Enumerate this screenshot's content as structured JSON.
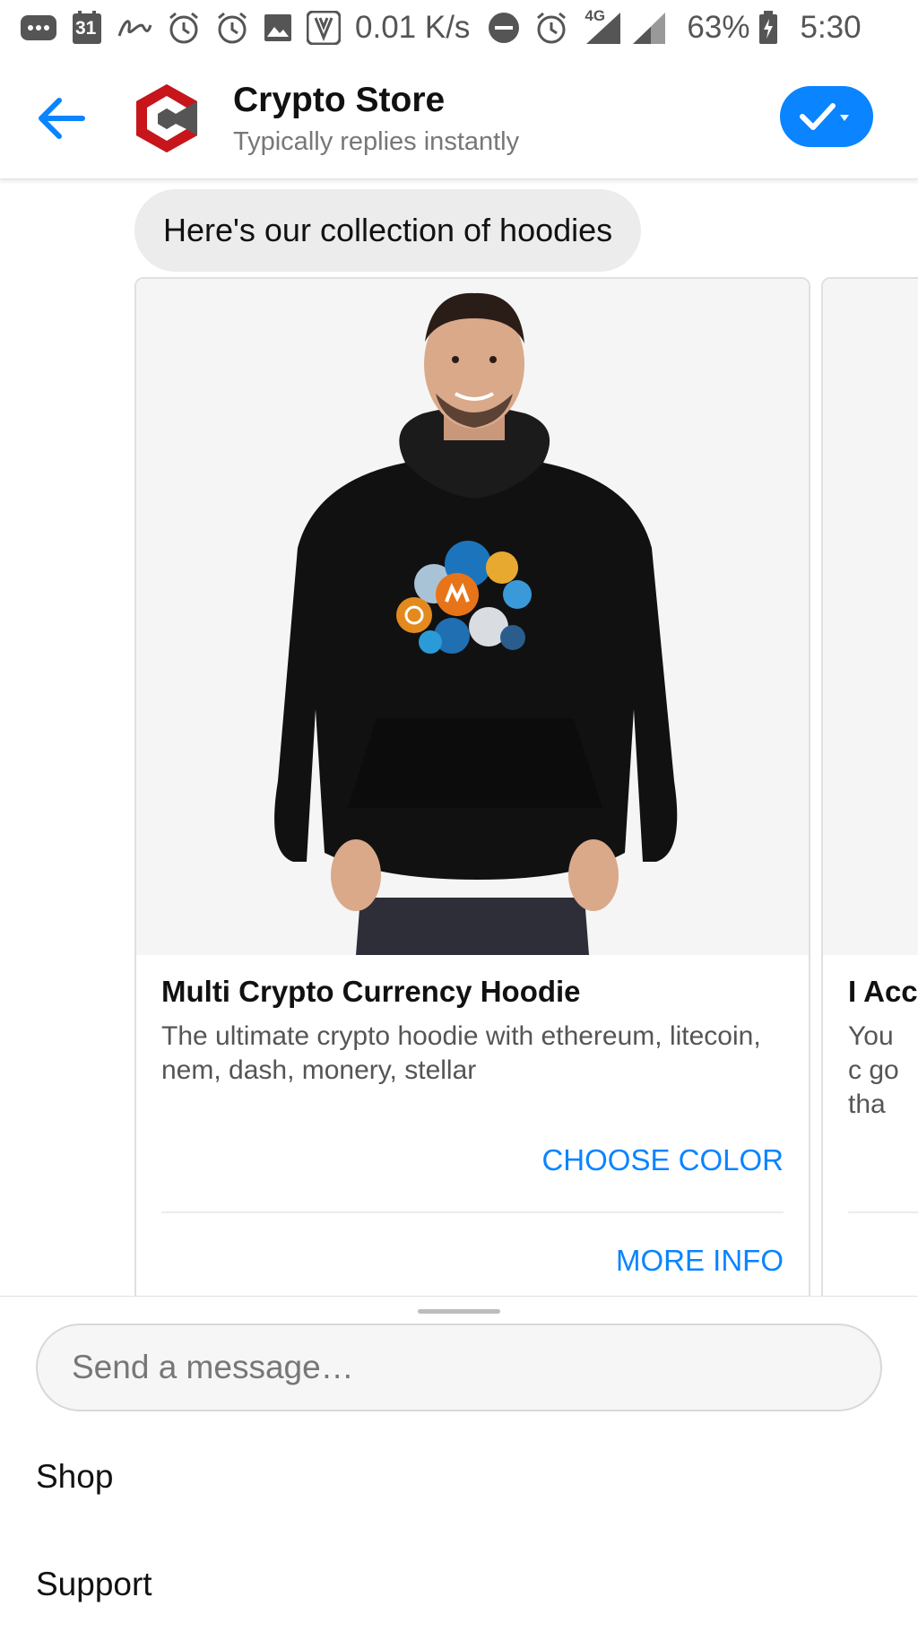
{
  "status_bar": {
    "calendar_day": "31",
    "net_speed": "0.01 K/s",
    "network": "4G",
    "battery": "63%",
    "time": "5:30",
    "icons": [
      "more-icon",
      "calendar-icon",
      "signature-icon",
      "alarm-icon",
      "alarm-icon",
      "image-icon",
      "app-icon",
      "dnd-icon",
      "alarm-icon",
      "signal-icon",
      "signal-icon",
      "battery-icon"
    ]
  },
  "header": {
    "title": "Crypto Store",
    "subtitle": "Typically replies instantly",
    "back_icon": "back-arrow-icon",
    "action_icon": "check-dropdown-icon",
    "accent_color": "#0a84ff"
  },
  "chat": {
    "bubble_text": "Here's our collection of hoodies",
    "cards": [
      {
        "title": "Multi Crypto Currency Hoodie",
        "description": "The ultimate crypto hoodie with ethereum, litecoin, nem, dash, monery, stellar",
        "buttons": [
          "CHOOSE COLOR",
          "MORE INFO"
        ]
      },
      {
        "title": "I Acc",
        "description": "You c go tha"
      }
    ]
  },
  "composer": {
    "placeholder": "Send a message…",
    "menu": [
      "Shop",
      "Support"
    ]
  }
}
